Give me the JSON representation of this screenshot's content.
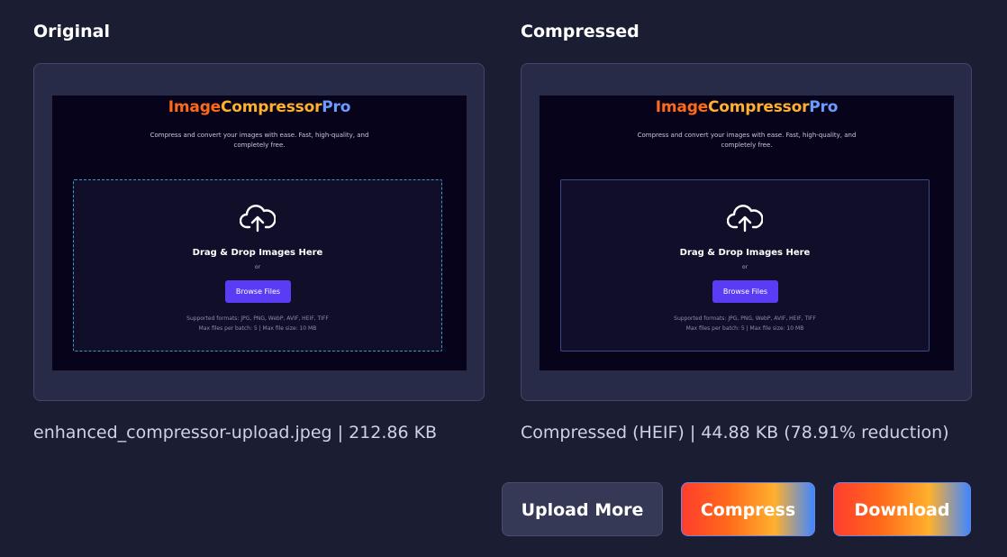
{
  "panels": {
    "original": {
      "title": "Original",
      "caption": "enhanced_compressor-upload.jpeg | 212.86 KB"
    },
    "compressed": {
      "title": "Compressed",
      "caption": "Compressed (HEIF) | 44.88 KB (78.91% reduction)"
    }
  },
  "preview": {
    "logo_part1": "Image",
    "logo_part2": "Compressor",
    "logo_part3": "Pro",
    "tagline": "Compress and convert your images with ease. Fast, high-quality, and completely free.",
    "dropzone_title": "Drag & Drop Images Here",
    "dropzone_or": "or",
    "browse_label": "Browse Files",
    "formats_line": "Supported formats: JPG, PNG, WebP, AVIF, HEIF, TIFF",
    "limits_line": "Max files per batch: 5 | Max file size: 10 MB",
    "icon": "cloud-upload-icon"
  },
  "actions": {
    "upload_more": "Upload More",
    "compress": "Compress",
    "download": "Download"
  },
  "colors": {
    "background": "#1b1e33",
    "frame": "#272b48",
    "browse_button": "#5b3cf5",
    "gradient": [
      "#ff3d2e",
      "#ffb02e",
      "#3f87ff"
    ]
  }
}
